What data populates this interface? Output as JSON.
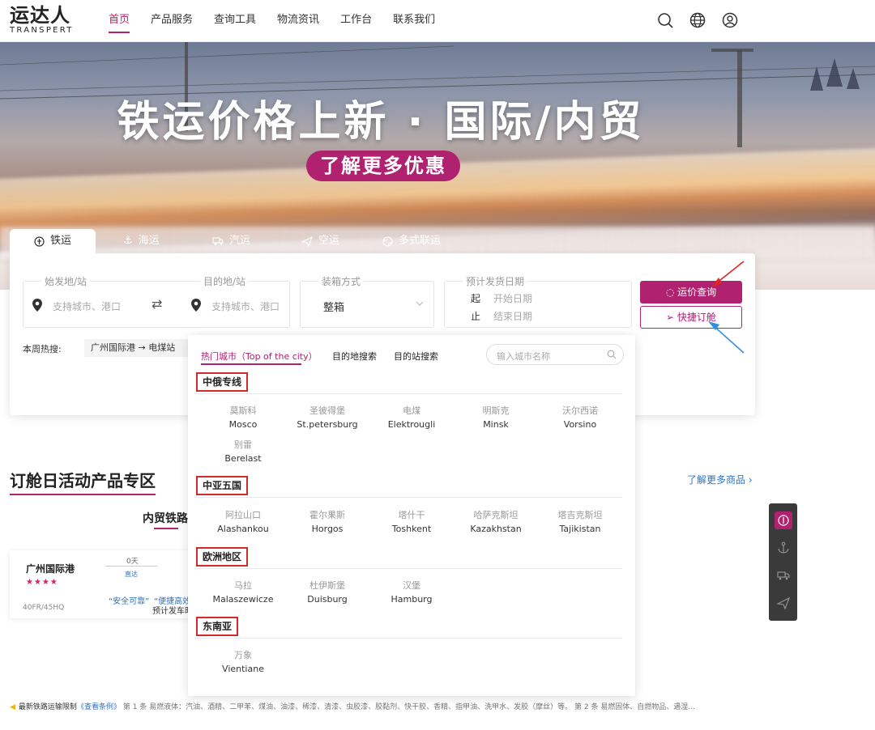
{
  "brand": {
    "name_cn": "运达人",
    "name_en": "TRANSPERT"
  },
  "nav": [
    "首页",
    "产品服务",
    "查询工具",
    "物流资讯",
    "工作台",
    "联系我们"
  ],
  "banner": {
    "title": "铁运价格上新 · 国际/内贸",
    "cta": "了解更多优惠"
  },
  "tabs": [
    {
      "label": "铁运",
      "icon": "rail-icon"
    },
    {
      "label": "海运",
      "icon": "anchor-icon"
    },
    {
      "label": "汽运",
      "icon": "truck-icon"
    },
    {
      "label": "空运",
      "icon": "plane-icon"
    },
    {
      "label": "多式联运",
      "icon": "globe-icon"
    }
  ],
  "search": {
    "origin_label": "始发地/站",
    "origin_placeholder": "支持城市、港口",
    "dest_label": "目的地/站",
    "dest_placeholder": "支持城市、港口",
    "swap": "⇄",
    "container_label": "装箱方式",
    "container_value": "整箱",
    "date_label": "预计发货日期",
    "date_start_label": "起",
    "date_start_placeholder": "开始日期",
    "date_end_label": "止",
    "date_end_placeholder": "结束日期",
    "query_button": "运价查询",
    "order_button": "快捷订舱",
    "hot_label": "本周热搜:",
    "hot_route": "广州国际港 → 电煤站"
  },
  "dropdown": {
    "tabs": [
      "热门城市（Top of the city）",
      "目的地搜索",
      "目的站搜索"
    ],
    "search_placeholder": "输入城市名称",
    "groups": [
      {
        "title": "中俄专线",
        "cities": [
          {
            "cn": "莫斯科",
            "en": "Mosco"
          },
          {
            "cn": "圣彼得堡",
            "en": "St.petersburg"
          },
          {
            "cn": "电煤",
            "en": "Elektrougli"
          },
          {
            "cn": "明斯克",
            "en": "Minsk"
          },
          {
            "cn": "沃尔西诺",
            "en": "Vorsino"
          },
          {
            "cn": "别雷",
            "en": "Berelast"
          }
        ]
      },
      {
        "title": "中亚五国",
        "cities": [
          {
            "cn": "阿拉山口",
            "en": "Alashankou"
          },
          {
            "cn": "霍尔果斯",
            "en": "Horgos"
          },
          {
            "cn": "塔什干",
            "en": "Toshkent"
          },
          {
            "cn": "哈萨克斯坦",
            "en": "Kazakhstan"
          },
          {
            "cn": "塔吉克斯坦",
            "en": "Tajikistan"
          }
        ]
      },
      {
        "title": "欧洲地区",
        "cities": [
          {
            "cn": "马拉",
            "en": "Malaszewicze"
          },
          {
            "cn": "杜伊斯堡",
            "en": "Duisburg"
          },
          {
            "cn": "汉堡",
            "en": "Hamburg"
          }
        ]
      },
      {
        "title": "东南亚",
        "cities": [
          {
            "cn": "万象",
            "en": "Vientiane"
          }
        ]
      }
    ]
  },
  "section": {
    "title": "订舱日活动产品专区",
    "more_link": "了解更多商品",
    "sub_tab": "内贸铁路"
  },
  "card": {
    "port": "广州国际港",
    "stars": "★★★★",
    "days": "0天",
    "direct": "直达",
    "tag1": "“安全可靠”",
    "tag2": "“便捷高效”",
    "spec": "40FR/45HQ",
    "departure": "预计发车时"
  },
  "ticker": {
    "label": "最新铁路运输限制",
    "link": "《查看条例》",
    "text": "第 1 条 易燃液体：汽油、酒精、二甲苯、煤油、油漆、稀漆、清漆、虫胶漆、胶黏剂、快干胶、香精、指甲油、洗甲水、发胶（摩丝）等。 第 2 条 易燃固体、自燃物品、遇湿…"
  }
}
